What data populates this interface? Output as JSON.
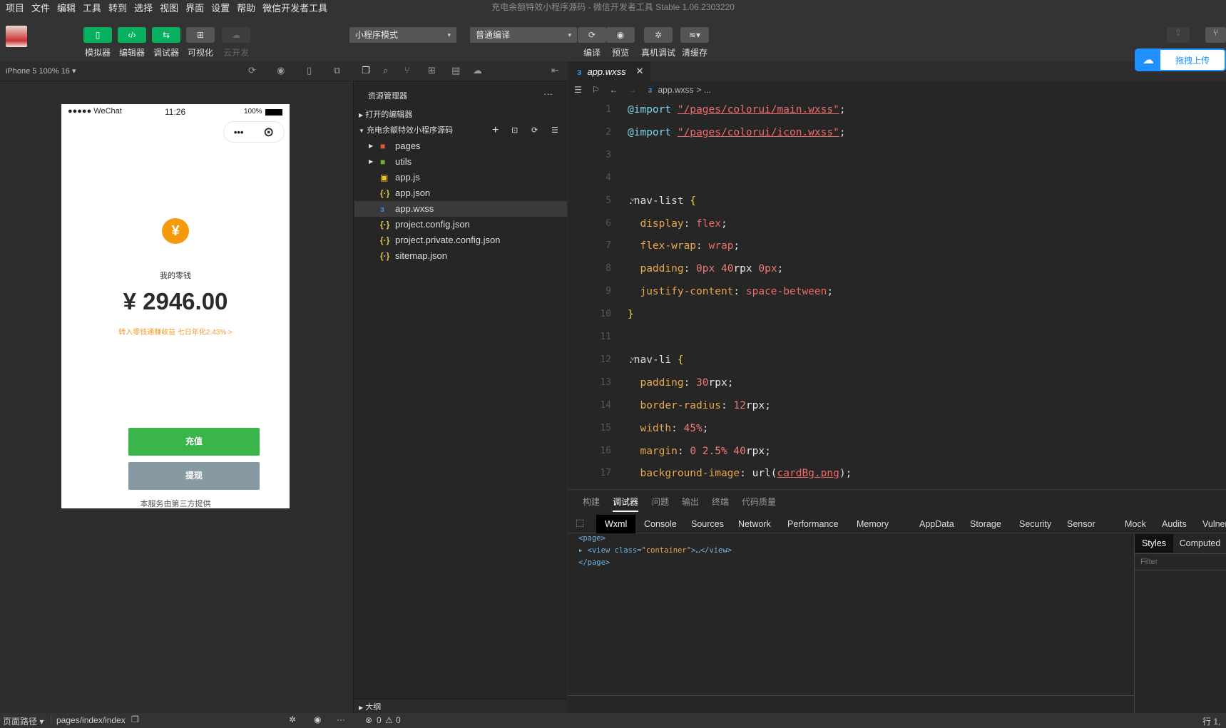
{
  "menu": [
    "项目",
    "文件",
    "编辑",
    "工具",
    "转到",
    "选择",
    "视图",
    "界面",
    "设置",
    "帮助",
    "微信开发者工具"
  ],
  "window_title": "充电余额特效小程序源码 - 微信开发者工具 Stable 1.06.2303220",
  "toolbar": {
    "simulator": "模拟器",
    "editor": "编辑器",
    "debugger": "调试器",
    "visual": "可视化",
    "cloud": "云开发",
    "mode_select": "小程序模式",
    "compile_select": "普通编译",
    "compile": "编译",
    "preview": "预览",
    "real_debug": "真机调试",
    "clear_cache": "清缓存",
    "upload_hint": "拖拽上传"
  },
  "simulator": {
    "device": "iPhone 5 100% 16 ▾",
    "status_left": "●●●●● WeChat",
    "time": "11:26",
    "battery": "100%",
    "yuan_icon": "¥",
    "label": "我的零钱",
    "amount": "¥ 2946.00",
    "promo": "转入零钱通赚收益 七日年化2.43% >",
    "recharge": "充值",
    "withdraw": "提现",
    "footer": "本服务由第三方提供"
  },
  "explorer": {
    "title": "资源管理器",
    "more": "···",
    "open_editors": "打开的编辑器",
    "project": "充电余额特效小程序源码",
    "outline": "大纲",
    "files": [
      {
        "name": "pages",
        "type": "folder",
        "color": "#e8563a"
      },
      {
        "name": "utils",
        "type": "folder",
        "color": "#6cb33e"
      },
      {
        "name": "app.js",
        "type": "js"
      },
      {
        "name": "app.json",
        "type": "json"
      },
      {
        "name": "app.wxss",
        "type": "wxss",
        "selected": true
      },
      {
        "name": "project.config.json",
        "type": "json"
      },
      {
        "name": "project.private.config.json",
        "type": "json"
      },
      {
        "name": "sitemap.json",
        "type": "json"
      }
    ]
  },
  "editor": {
    "tab": "app.wxss",
    "breadcrumb": "app.wxss",
    "breadcrumb_tail": "> ...",
    "lines": [
      [
        [
          "@import",
          "at"
        ],
        [
          " ",
          "p"
        ],
        [
          "\"/pages/colorui/main.wxss\"",
          "str"
        ],
        [
          ";",
          "pun"
        ]
      ],
      [
        [
          "@import",
          "at"
        ],
        [
          " ",
          "p"
        ],
        [
          "\"/pages/colorui/icon.wxss\"",
          "str"
        ],
        [
          ";",
          "pun"
        ]
      ],
      [],
      [],
      [
        [
          ".nav-list ",
          "sel"
        ],
        [
          "{",
          "br"
        ]
      ],
      [
        [
          "  display",
          "prop"
        ],
        [
          ": ",
          "pun"
        ],
        [
          "flex",
          "val"
        ],
        [
          ";",
          "pun"
        ]
      ],
      [
        [
          "  flex-wrap",
          "prop"
        ],
        [
          ": ",
          "pun"
        ],
        [
          "wrap",
          "val"
        ],
        [
          ";",
          "pun"
        ]
      ],
      [
        [
          "  padding",
          "prop"
        ],
        [
          ": ",
          "pun"
        ],
        [
          "0px",
          "num"
        ],
        [
          " ",
          "p"
        ],
        [
          "40",
          "num"
        ],
        [
          "rpx ",
          "fn"
        ],
        [
          "0px",
          "num"
        ],
        [
          ";",
          "pun"
        ]
      ],
      [
        [
          "  justify-content",
          "prop"
        ],
        [
          ": ",
          "pun"
        ],
        [
          "space-between",
          "val"
        ],
        [
          ";",
          "pun"
        ]
      ],
      [
        [
          "}",
          "br"
        ]
      ],
      [],
      [
        [
          ".nav-li ",
          "sel"
        ],
        [
          "{",
          "br"
        ]
      ],
      [
        [
          "  padding",
          "prop"
        ],
        [
          ": ",
          "pun"
        ],
        [
          "30",
          "num"
        ],
        [
          "rpx",
          "fn"
        ],
        [
          ";",
          "pun"
        ]
      ],
      [
        [
          "  border-radius",
          "prop"
        ],
        [
          ": ",
          "pun"
        ],
        [
          "12",
          "num"
        ],
        [
          "rpx",
          "fn"
        ],
        [
          ";",
          "pun"
        ]
      ],
      [
        [
          "  width",
          "prop"
        ],
        [
          ": ",
          "pun"
        ],
        [
          "45%",
          "num"
        ],
        [
          ";",
          "pun"
        ]
      ],
      [
        [
          "  margin",
          "prop"
        ],
        [
          ": ",
          "pun"
        ],
        [
          "0 2.5% 40",
          "num"
        ],
        [
          "rpx",
          "fn"
        ],
        [
          ";",
          "pun"
        ]
      ],
      [
        [
          "  background-image",
          "prop"
        ],
        [
          ": ",
          "pun"
        ],
        [
          "url(",
          "fn"
        ],
        [
          "cardBg.png",
          "str"
        ],
        [
          ");",
          "pun"
        ]
      ]
    ]
  },
  "panel": {
    "tabs": [
      "构建",
      "调试器",
      "问题",
      "输出",
      "终端",
      "代码质量"
    ],
    "active_tab": "调试器",
    "devtools": [
      "Wxml",
      "Console",
      "Sources",
      "Network",
      "Performance",
      "Memory",
      "AppData",
      "Storage",
      "Security",
      "Sensor",
      "Mock",
      "Audits",
      "Vulnerability"
    ],
    "wxml": [
      "<page>",
      "<view class=\"container\">…</view>",
      "</page>"
    ],
    "styles": "Styles",
    "computed": "Computed",
    "filter_placeholder": "Filter"
  },
  "status": {
    "page_path": "页面路径 ▾",
    "path": "pages/index/index",
    "errors": "0",
    "warnings": "0",
    "cursor": "行 1,"
  }
}
